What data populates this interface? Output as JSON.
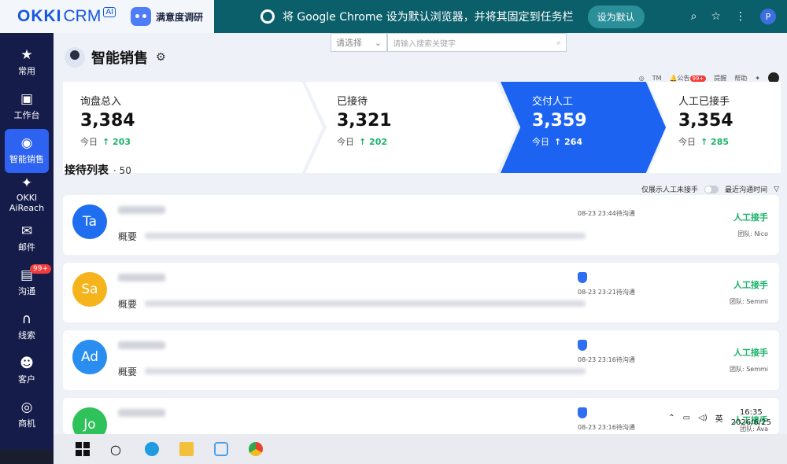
{
  "app": {
    "brand_okki": "OKKI",
    "brand_crm": "CRM",
    "brand_ai": "AI",
    "survey": "满意度调研"
  },
  "chrome_bar": {
    "message": "将 Google Chrome 设为默认浏览器，并将其固定到任务栏",
    "button": "设为默认",
    "profile": "P"
  },
  "sidebar": {
    "items": [
      {
        "label": "常用",
        "icon": "star-icon"
      },
      {
        "label": "工作台",
        "icon": "desk-icon"
      },
      {
        "label": "智能销售",
        "icon": "robot-icon",
        "active": true
      },
      {
        "label": "OKKI AiReach",
        "icon": "sparkle-icon"
      },
      {
        "label": "邮件",
        "icon": "mail-icon"
      },
      {
        "label": "沟通",
        "icon": "chat-icon",
        "badge": "99+"
      },
      {
        "label": "线索",
        "icon": "magnet-icon"
      },
      {
        "label": "客户",
        "icon": "people-icon"
      },
      {
        "label": "商机",
        "icon": "target-icon"
      }
    ]
  },
  "header": {
    "title": "智能销售",
    "select_placeholder": "请选择",
    "search_placeholder": "请输入搜索关键字",
    "tools": {
      "tm": "TM",
      "notice": "公告",
      "notice_badge": "99+",
      "remind": "提醒",
      "help": "帮助"
    }
  },
  "funnel": [
    {
      "label": "询盘总入",
      "value": "3,384",
      "today_label": "今日",
      "delta": "↑ 203"
    },
    {
      "label": "已接待",
      "value": "3,321",
      "today_label": "今日",
      "delta": "↑ 202"
    },
    {
      "label": "交付人工",
      "value": "3,359",
      "today_label": "今日",
      "delta": "↑ 264"
    },
    {
      "label": "人工已接手",
      "value": "3,354",
      "today_label": "今日",
      "delta": "↑ 285"
    }
  ],
  "list": {
    "title": "接待列表",
    "count": "· 50",
    "only_manual": "仅展示人工未接手",
    "sort": "最近沟通时间",
    "summary_label": "概要",
    "cards": [
      {
        "initials": "Ta",
        "color": "#1f6ef0",
        "time": "08-23 23:44待沟通",
        "status": "人工接手",
        "team": "团队: Nico"
      },
      {
        "initials": "Sa",
        "color": "#f5b41c",
        "time": "08-23 23:21待沟通",
        "status": "人工接手",
        "team": "团队: Semmi"
      },
      {
        "initials": "Ad",
        "color": "#2a8df0",
        "time": "08-23 23:16待沟通",
        "status": "人工接手",
        "team": "团队: Semmi"
      },
      {
        "initials": "Jo",
        "color": "#2fc15a",
        "time": "08-23 23:16待沟通",
        "status": "人工接手",
        "team": "团队: Ava"
      }
    ]
  },
  "taskbar": {
    "ime": "英",
    "time": "16:35",
    "date": "2026/6/25"
  }
}
